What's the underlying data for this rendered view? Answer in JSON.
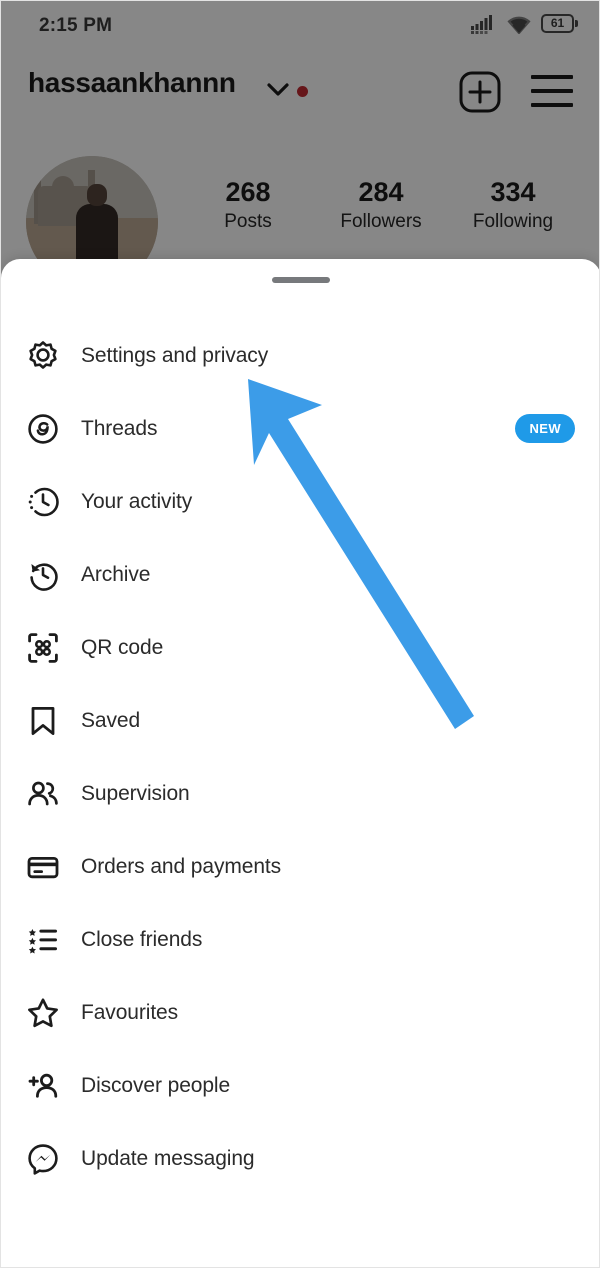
{
  "status_bar": {
    "time": "2:15 PM",
    "battery_level": "61",
    "signal_icon": "signal-bars-icon",
    "wifi_icon": "wifi-icon",
    "battery_icon": "battery-icon"
  },
  "profile": {
    "username": "hassaankhannn",
    "chevron_icon": "chevron-down-icon",
    "notification_dot": "red-dot-indicator",
    "add_icon": "plus-square-icon",
    "menu_icon": "hamburger-menu-icon",
    "avatar": "profile-avatar-photo",
    "stats": [
      {
        "value": "268",
        "label": "Posts"
      },
      {
        "value": "284",
        "label": "Followers"
      },
      {
        "value": "334",
        "label": "Following"
      }
    ]
  },
  "sheet": {
    "drag_handle": "drag-handle",
    "items": [
      {
        "label": "Settings and privacy",
        "icon": "gear-icon",
        "badge": ""
      },
      {
        "label": "Threads",
        "icon": "threads-icon",
        "badge": "NEW"
      },
      {
        "label": "Your activity",
        "icon": "activity-clock-icon",
        "badge": ""
      },
      {
        "label": "Archive",
        "icon": "archive-clock-icon",
        "badge": ""
      },
      {
        "label": "QR code",
        "icon": "qr-code-icon",
        "badge": ""
      },
      {
        "label": "Saved",
        "icon": "bookmark-icon",
        "badge": ""
      },
      {
        "label": "Supervision",
        "icon": "people-icon",
        "badge": ""
      },
      {
        "label": "Orders and payments",
        "icon": "credit-card-icon",
        "badge": ""
      },
      {
        "label": "Close friends",
        "icon": "star-list-icon",
        "badge": ""
      },
      {
        "label": "Favourites",
        "icon": "star-icon",
        "badge": ""
      },
      {
        "label": "Discover people",
        "icon": "person-add-icon",
        "badge": ""
      },
      {
        "label": "Update messaging",
        "icon": "messenger-icon",
        "badge": ""
      }
    ]
  },
  "cursor": {
    "icon": "blue-arrow-pointer",
    "color": "#3c9ce8",
    "points_at": "Settings and privacy"
  },
  "colors": {
    "overlay": "#808080",
    "sheet_background": "#ffffff",
    "badge_blue": "#1f9ae8",
    "text_primary": "#2b2b2b",
    "notification_red": "#c02b32"
  }
}
